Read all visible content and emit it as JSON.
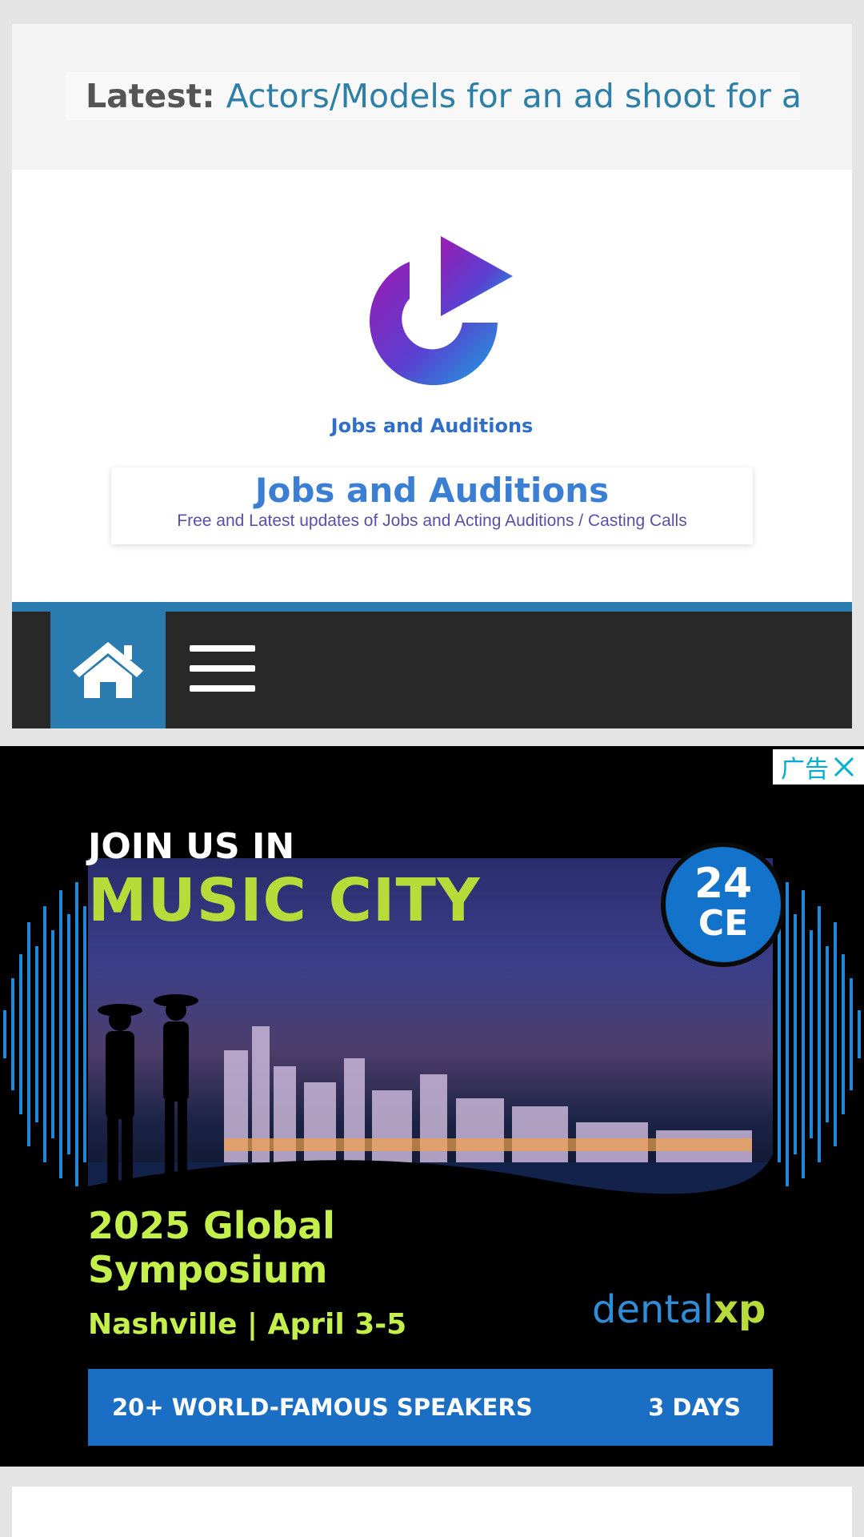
{
  "ticker": {
    "label": "Latest:",
    "headline": "Actors/Models for an ad shoot for an"
  },
  "site": {
    "logo_caption": "Jobs and Auditions",
    "title": "Jobs and Auditions",
    "tagline": "Free and Latest updates of Jobs and Acting Auditions / Casting Calls"
  },
  "nav": {
    "home_icon": "home-icon",
    "menu_icon": "hamburger-menu-icon"
  },
  "ad": {
    "flag_label": "广告",
    "close_icon": "close-icon",
    "join_text": "JOIN US IN",
    "headline": "MUSIC CITY",
    "ce_number": "24",
    "ce_label": "CE",
    "event_line1": "2025 Global",
    "event_line2": "Symposium",
    "location": "Nashville | April 3-5",
    "brand_main": "dental",
    "brand_accent": "xp",
    "bar_left": "20+ WORLD-FAMOUS SPEAKERS",
    "bar_right": "3 DAYS"
  },
  "colors": {
    "accent": "#2a7cb0",
    "nav_dark": "#282828",
    "link": "#2d7fa8",
    "ad_green": "#c4f04b"
  }
}
